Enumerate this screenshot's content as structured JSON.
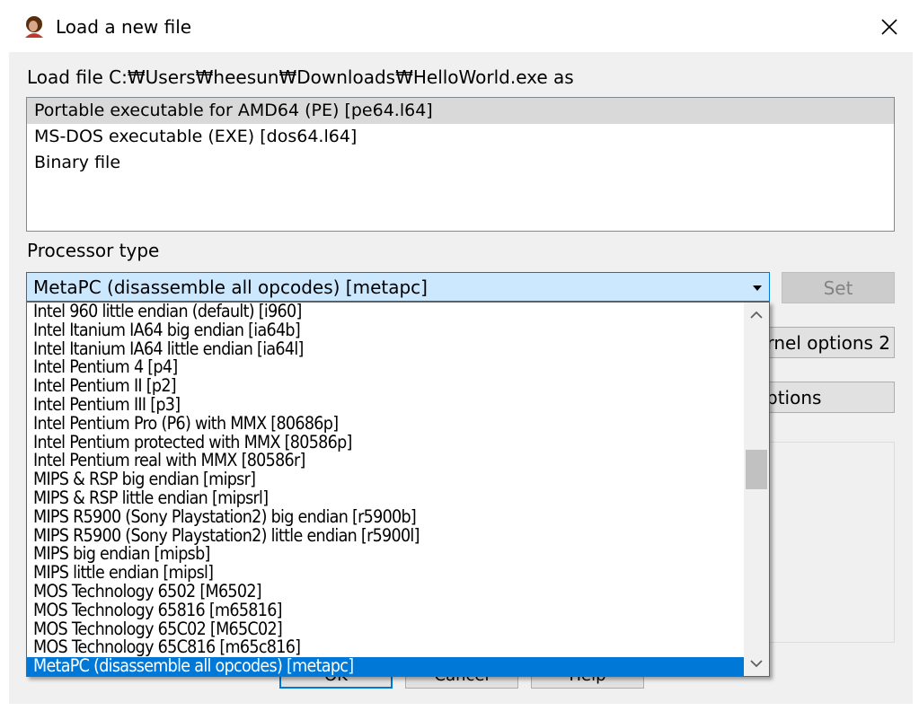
{
  "window": {
    "title": "Load a new file",
    "close_glyph": "✕"
  },
  "load_label": "Load file C:₩Users₩heesun₩Downloads₩HelloWorld.exe as",
  "loaders": [
    {
      "label": "Portable executable for AMD64 (PE) [pe64.l64]",
      "selected": true
    },
    {
      "label": "MS-DOS executable (EXE) [dos64.l64]",
      "selected": false
    },
    {
      "label": "Binary file",
      "selected": false
    }
  ],
  "processor": {
    "label": "Processor type",
    "selected": "MetaPC (disassemble all opcodes) [metapc]",
    "options": [
      "Intel 960 little endian (default) [i960]",
      "Intel Itanium IA64 big endian [ia64b]",
      "Intel Itanium IA64 little endian [ia64l]",
      "Intel Pentium 4 [p4]",
      "Intel Pentium II [p2]",
      "Intel Pentium III [p3]",
      "Intel Pentium Pro (P6) with MMX [80686p]",
      "Intel Pentium protected with MMX [80586p]",
      "Intel Pentium real with MMX [80586r]",
      "MIPS & RSP big endian [mipsr]",
      "MIPS & RSP little endian [mipsrl]",
      "MIPS R5900 (Sony Playstation2) big endian [r5900b]",
      "MIPS R5900 (Sony Playstation2) little endian [r5900l]",
      "MIPS big endian [mipsb]",
      "MIPS little endian [mipsl]",
      "MOS Technology 6502 [M6502]",
      "MOS Technology 65816 [m65816]",
      "MOS Technology 65C02 [M65C02]",
      "MOS Technology 65C816 [m65c816]",
      "MetaPC (disassemble all opcodes) [metapc]"
    ],
    "selected_index": 19,
    "scroll_position": 0.43
  },
  "buttons": {
    "set": "Set",
    "kernel_options_2": "rnel options 2",
    "options_partial": "ptions",
    "ok": "OK",
    "cancel": "Cancel",
    "help": "Help"
  },
  "colors": {
    "accent": "#0078d7",
    "combo_bg": "#cce8ff",
    "selection_gray": "#d9d9d9"
  }
}
